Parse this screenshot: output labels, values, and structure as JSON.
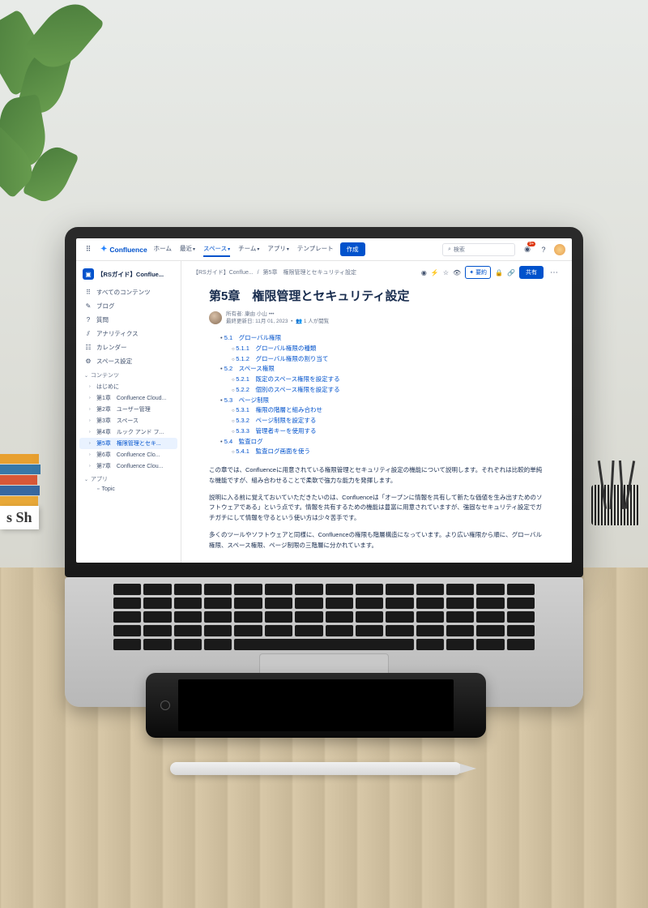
{
  "topbar": {
    "product": "Confluence",
    "nav": [
      "ホーム",
      "最近",
      "スペース",
      "チーム",
      "アプリ",
      "テンプレート"
    ],
    "active_nav_index": 2,
    "create": "作成",
    "search_placeholder": "検索"
  },
  "sidebar": {
    "space_name": "【RSガイド】Conflue...",
    "nav": [
      {
        "icon": "⠿",
        "label": "すべてのコンテンツ"
      },
      {
        "icon": "✎",
        "label": "ブログ"
      },
      {
        "icon": "?",
        "label": "質問"
      },
      {
        "icon": "⫽",
        "label": "アナリティクス"
      },
      {
        "icon": "☷",
        "label": "カレンダー"
      },
      {
        "icon": "⚙",
        "label": "スペース設定"
      }
    ],
    "sections": {
      "content_label": "コンテンツ",
      "apps_label": "アプリ"
    },
    "tree": [
      {
        "label": "はじめに"
      },
      {
        "label": "第1章　Confluence Cloud..."
      },
      {
        "label": "第2章　ユーザー管理"
      },
      {
        "label": "第3章　スペース"
      },
      {
        "label": "第4章　ルック アンド フ..."
      },
      {
        "label": "第5章　権限管理とセキ...",
        "selected": true
      },
      {
        "label": "第6章　Confluence Clo..."
      },
      {
        "label": "第7章　Confluence Clou..."
      }
    ],
    "apps": [
      {
        "label": "Topic"
      }
    ]
  },
  "breadcrumb": {
    "space": "【RSガイド】Conflue...",
    "page": "第5章　権限管理とセキュリティ設定"
  },
  "actions": {
    "summary_label": "要約",
    "share_label": "共有"
  },
  "page": {
    "title": "第5章　権限管理とセキュリティ設定",
    "owner_label": "所有者:",
    "owner_name": "康由 小山",
    "updated_label": "最終更新日:",
    "updated": "11月 01, 2023",
    "views": "1 人が閲覧"
  },
  "toc": [
    {
      "num": "5.1",
      "label": "グローバル権限",
      "children": [
        {
          "num": "5.1.1",
          "label": "グローバル権限の種類"
        },
        {
          "num": "5.1.2",
          "label": "グローバル権限の割り当て"
        }
      ]
    },
    {
      "num": "5.2",
      "label": "スペース権限",
      "children": [
        {
          "num": "5.2.1",
          "label": "既定のスペース権限を設定する"
        },
        {
          "num": "5.2.2",
          "label": "個別のスペース権限を設定する"
        }
      ]
    },
    {
      "num": "5.3",
      "label": "ページ制限",
      "children": [
        {
          "num": "5.3.1",
          "label": "権限の階層と組み合わせ"
        },
        {
          "num": "5.3.2",
          "label": "ページ制限を設定する"
        },
        {
          "num": "5.3.3",
          "label": "管理者キーを使用する"
        }
      ]
    },
    {
      "num": "5.4",
      "label": "監査ログ",
      "children": [
        {
          "num": "5.4.1",
          "label": "監査ログ画面を使う"
        }
      ]
    }
  ],
  "body": {
    "p1": "この章では、Confluenceに用意されている権限管理とセキュリティ設定の機能について説明します。それぞれは比較的単純な機能ですが、組み合わせることで柔軟で強力な能力を発揮します。",
    "p2": "説明に入る前に覚えておいていただきたいのは、Confluenceは「オープンに情報を共有して新たな価値を生み出すためのソフトウェアである」という点です。情報を共有するための機能は豊富に用意されていますが、強固なセキュリティ設定でガチガチにして情報を守るという使い方は少々苦手です。",
    "p3": "多くのツールやソフトウェアと同様に、Confluenceの権限も階層構造になっています。より広い権限から順に、グローバル権限、スペース権限、ページ制限の三階層に分かれています。"
  }
}
